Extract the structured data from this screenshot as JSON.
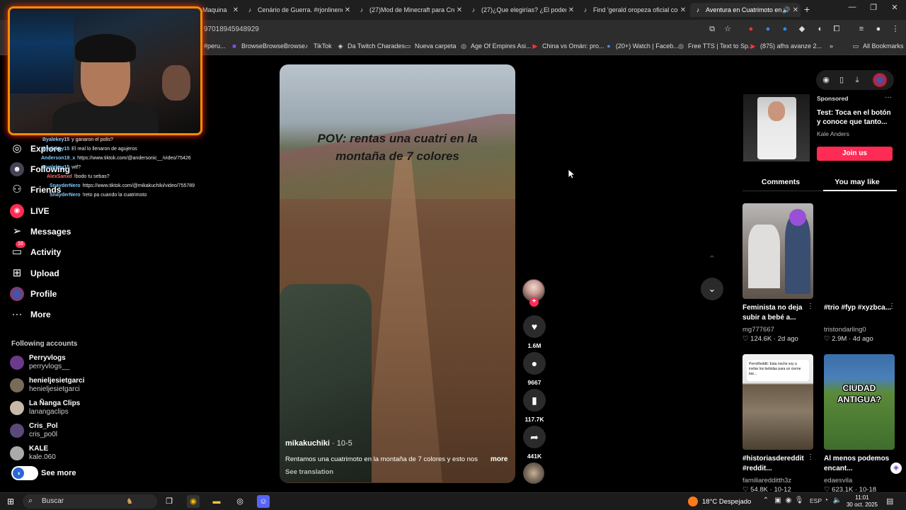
{
  "browser": {
    "tabs": [
      {
        "title": "Maquina",
        "active": false,
        "icon": "globe-icon"
      },
      {
        "title": "Cenário de Guerra. #rjonlinenc",
        "active": false,
        "icon": "tiktok-icon"
      },
      {
        "title": "(27)Mod de Minecraft para Cre",
        "active": false,
        "icon": "tiktok-icon"
      },
      {
        "title": "(27)¿Que elegirías? ¿El poder d",
        "active": false,
        "icon": "tiktok-icon"
      },
      {
        "title": "Find 'gerald oropeza oficial cor",
        "active": false,
        "icon": "tiktok-icon"
      },
      {
        "title": "Aventura en Cuatrimoto en",
        "active": true,
        "icon": "tiktok-icon"
      }
    ],
    "url": "97018945948929",
    "bookmarks": [
      {
        "label": "#peru...",
        "icon": "tiktok-icon"
      },
      {
        "label": "BrowseBrowseBrowse",
        "icon": "twitch-icon"
      },
      {
        "label": "TikTok",
        "icon": "tiktok-icon"
      },
      {
        "label": "Da Twitch Charades",
        "icon": "bookmark-icon"
      },
      {
        "label": "Nueva carpeta",
        "icon": "folder-icon"
      },
      {
        "label": "Age Of Empires Asi...",
        "icon": "globe-icon"
      },
      {
        "label": "China vs Omán: pro...",
        "icon": "youtube-icon"
      },
      {
        "label": "(20+) Watch | Faceb...",
        "icon": "facebook-icon"
      },
      {
        "label": "Free TTS | Text to Sp...",
        "icon": "globe-icon"
      },
      {
        "label": "(875) afhs avanze 2...",
        "icon": "youtube-icon"
      }
    ],
    "all_bookmarks": "All Bookmarks"
  },
  "chat": [
    {
      "user": "Byalekey15",
      "msg": "y ganaron el polis?"
    },
    {
      "user": "Byalekey15",
      "msg": "El real lo llenaron de agujeros"
    },
    {
      "user": "Anderson19_x",
      "msg": "https://www.tiktok.com/@andersonic__/video/75426"
    },
    {
      "user": "Byalekey15",
      "msg": "wtf?"
    },
    {
      "user": "AlexSanxd",
      "msg": "!bodo tu sebas?"
    },
    {
      "user": "SnayderNero",
      "msg": "https://www.tiktok.com/@mikakuchiki/video/755789"
    },
    {
      "user": "SnayderNero",
      "msg": "!reto pa cuando la cuatrimoto"
    }
  ],
  "sidebar": {
    "nav": [
      {
        "label": "Explore",
        "icon": "compass-icon"
      },
      {
        "label": "Following",
        "icon": "following-icon"
      },
      {
        "label": "Friends",
        "icon": "friends-icon"
      },
      {
        "label": "LIVE",
        "icon": "live-icon"
      },
      {
        "label": "Messages",
        "icon": "paper-plane-icon"
      },
      {
        "label": "Activity",
        "icon": "activity-icon",
        "badge": "16"
      },
      {
        "label": "Upload",
        "icon": "upload-icon"
      },
      {
        "label": "Profile",
        "icon": "profile-icon"
      },
      {
        "label": "More",
        "icon": "more-icon"
      }
    ],
    "following_heading": "Following accounts",
    "following": [
      {
        "name": "Perryvlogs",
        "handle": "perryvlogs__",
        "color": "#6b3a8a"
      },
      {
        "name": "henieljesietgarci",
        "handle": "henieljesietgarci",
        "color": "#7a6a5a"
      },
      {
        "name": "La Ñanga Clips",
        "handle": "lanangaclips",
        "color": "#c8b8a8"
      },
      {
        "name": "Cris_Pol",
        "handle": "cris_po0l",
        "color": "#5a4a7a"
      },
      {
        "name": "KALE",
        "handle": "kale.060",
        "color": "#aaaaaa"
      }
    ],
    "see_more": "See more"
  },
  "video": {
    "overlay_text": "POV: rentas una cuatri en la montaña de 7 colores",
    "author": "mikakuchiki",
    "date": "10-5",
    "description": "Rentamos una cuatrimoto en la montaña de 7 colores y esto nos",
    "more": "more",
    "see_translation": "See translation"
  },
  "actions": {
    "likes": "1.6M",
    "comments": "9667",
    "saves": "117.7K",
    "shares": "441K"
  },
  "right_panel": {
    "sponsored_label": "Sponsored",
    "sponsored_title": "Test: Toca en el botón y conoce que tanto...",
    "sponsored_author": "Kale Anders",
    "join_label": "Join us",
    "tabs": [
      "Comments",
      "You may like"
    ],
    "cards": [
      {
        "title": "Feminista no deja subir a bebé a...",
        "author": "mg777667",
        "likes": "124.6K",
        "date": "2d ago"
      },
      {
        "title": "#trio #fyp #xyzbca...",
        "author": "tristondarling0",
        "likes": "2.9M",
        "date": "4d ago"
      },
      {
        "title": "#historiasdereddit #reddit...",
        "author": "familiaredditth3z",
        "likes": "54.8K",
        "date": "10-12",
        "thumb_text": "PerroReddit: Esta noche voy a invitar los bebidas para un cierne bar..."
      },
      {
        "title": "Al menos podemos encant...",
        "author": "edaesvila",
        "likes": "623.1K",
        "date": "10-18",
        "thumb_text": "CIUDAD ANTIGUA?"
      }
    ]
  },
  "taskbar": {
    "search": "Buscar",
    "weather": "18°C  Despejado",
    "lang": "ESP",
    "time": "11:01",
    "date": "30 oct. 2025"
  }
}
